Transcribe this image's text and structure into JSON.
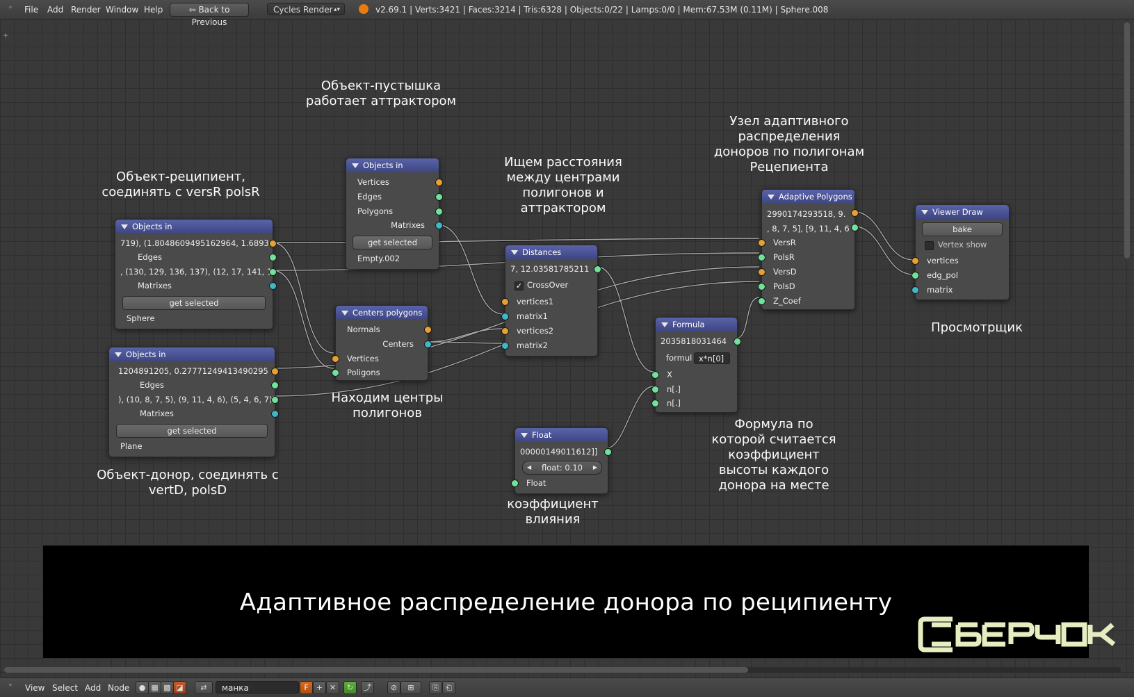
{
  "header": {
    "menu": [
      "File",
      "Add",
      "Render",
      "Window",
      "Help"
    ],
    "back_button": "Back to Previous",
    "render_engine": "Cycles Render",
    "stats": "v2.69.1 | Verts:3421 | Faces:3214 | Tris:6328 | Objects:0/22 | Lamps:0/0 | Mem:67.53M (0.11M) | Sphere.008"
  },
  "nodes": {
    "obj_sphere": {
      "title": "Objects in",
      "rows": [
        "719), (1.8048609495162964, 1.6893",
        "Edges",
        ", (130, 129, 136, 137), (12, 17, 141, 1",
        "Matrixes"
      ],
      "button": "get selected",
      "object": "Sphere"
    },
    "obj_plane": {
      "title": "Objects in",
      "rows": [
        "1204891205, 0.27771249413490295",
        "Edges",
        "), (10, 8, 7, 5), (9, 11, 4, 6), (5, 4, 6, 7)]]",
        "Matrixes"
      ],
      "button": "get selected",
      "object": "Plane"
    },
    "obj_empty": {
      "title": "Objects in",
      "rows": [
        "Vertices",
        "Edges",
        "Polygons",
        "Matrixes"
      ],
      "button": "get selected",
      "object": "Empty.002"
    },
    "centers": {
      "title": "Centers polygons",
      "outputs": [
        "Normals",
        "Centers"
      ],
      "inputs": [
        "Vertices",
        "Poligons"
      ]
    },
    "distances": {
      "title": "Distances",
      "output": "7, 12.03581785211",
      "checkbox": "CrossOver",
      "inputs": [
        "vertices1",
        "matrix1",
        "vertices2",
        "matrix2"
      ]
    },
    "adaptive": {
      "title": "Adaptive Polygons",
      "outputs": [
        "2990174293518, 9.",
        ", 8, 7, 5], [9, 11, 4, 6"
      ],
      "inputs": [
        "VersR",
        "PolsR",
        "VersD",
        "PolsD",
        "Z_Coef"
      ]
    },
    "viewer": {
      "title": "Viewer Draw",
      "button": "bake",
      "checkbox": "Vertex show",
      "inputs": [
        "vertices",
        "edg_pol",
        "matrix"
      ]
    },
    "formula": {
      "title": "Formula",
      "output": "2035818031464",
      "formula_label": "formul",
      "formula_value": "x*n[0]",
      "inputs": [
        "X",
        "n[.]",
        "n[.]"
      ]
    },
    "float": {
      "title": "Float",
      "output": "00000149011612]]",
      "value": "float: 0.10",
      "input": "Float"
    }
  },
  "notes": {
    "empty": "Объект-пустышка\nработает аттрактором",
    "recipient": "Объект-реципиент,\nсоединять с versR polsR",
    "distances": "Ищем расстояния\nмежду центрами\nполигонов и\nаттрактором",
    "adaptive": "Узел адаптивного\nраспределения\nдоноров по полигонам\nРецепиента",
    "viewer": "Просмотрщик",
    "centers": "Находим центры\nполигонов",
    "donor": "Объект-донор, соединять с\nvertD, polsD",
    "formula": "Формула по\nкоторой считается\nкоэффициент\nвысоты каждого\nдонора на месте",
    "float": "коэффициент\nвлияния"
  },
  "banner": {
    "title": "Адаптивное распределение донора по реципиенту",
    "brand": "СВЕРЧОК"
  },
  "footer": {
    "menu": [
      "View",
      "Select",
      "Add",
      "Node"
    ],
    "tree_name": "манка",
    "fake_user": "F"
  },
  "colors": {
    "socket_orange": "#e8a030",
    "socket_green": "#6fe39a",
    "socket_blue": "#3fb9c8",
    "node_header": "#4a529a",
    "brand_color": "#e6edc0"
  }
}
